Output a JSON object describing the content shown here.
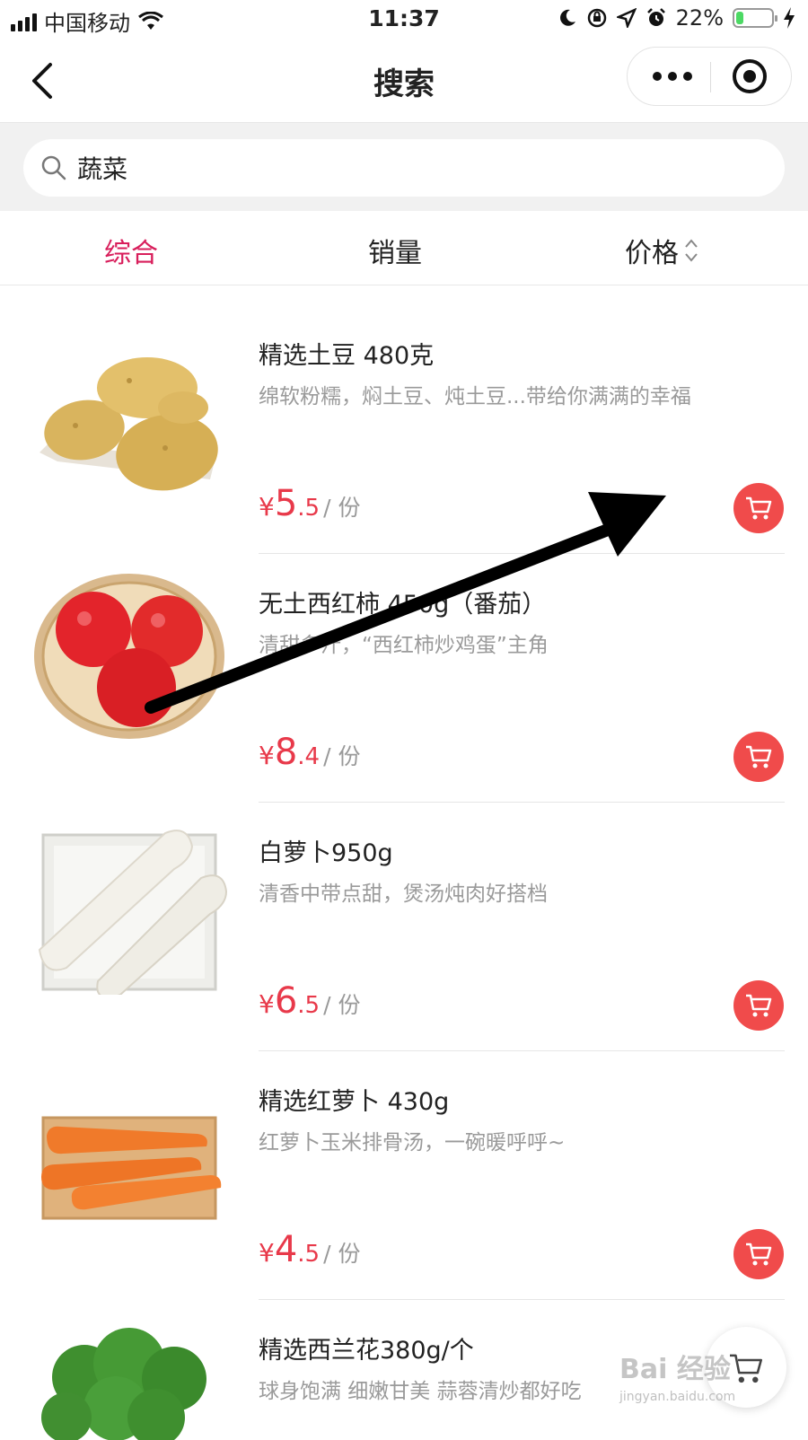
{
  "status": {
    "carrier": "中国移动",
    "time": "11:37",
    "battery": "22%",
    "battery_level": 0.22
  },
  "nav": {
    "title": "搜索"
  },
  "search": {
    "value": "蔬菜"
  },
  "tabs": [
    {
      "label": "综合",
      "active": true
    },
    {
      "label": "销量",
      "active": false
    },
    {
      "label": "价格",
      "active": false
    }
  ],
  "products": [
    {
      "title": "精选土豆 480克",
      "desc": "绵软粉糯，焖土豆、炖土豆...带给你满满的幸福",
      "currency": "¥",
      "price_int": "5",
      "price_dec": ".5",
      "unit": "/ 份",
      "image": "potato"
    },
    {
      "title": "无土西红柿 450g（番茄）",
      "desc": "清甜多汁，“西红柿炒鸡蛋”主角",
      "currency": "¥",
      "price_int": "8",
      "price_dec": ".4",
      "unit": "/ 份",
      "image": "tomato"
    },
    {
      "title": "白萝卜950g",
      "desc": "清香中带点甜，煲汤炖肉好搭档",
      "currency": "¥",
      "price_int": "6",
      "price_dec": ".5",
      "unit": "/ 份",
      "image": "white-radish"
    },
    {
      "title": "精选红萝卜 430g",
      "desc": "红萝卜玉米排骨汤，一碗暖呼呼~",
      "currency": "¥",
      "price_int": "4",
      "price_dec": ".5",
      "unit": "/ 份",
      "image": "carrot"
    },
    {
      "title": "精选西兰花380g/个",
      "desc": "球身饱满 细嫩甘美 蒜蓉清炒都好吃",
      "image": "broccoli"
    }
  ],
  "watermark": {
    "brand": "Bai 经验",
    "url": "jingyan.baidu.com"
  },
  "colors": {
    "accent": "#d81e5b",
    "price": "#e8394a",
    "cart": "#f04b4b"
  }
}
